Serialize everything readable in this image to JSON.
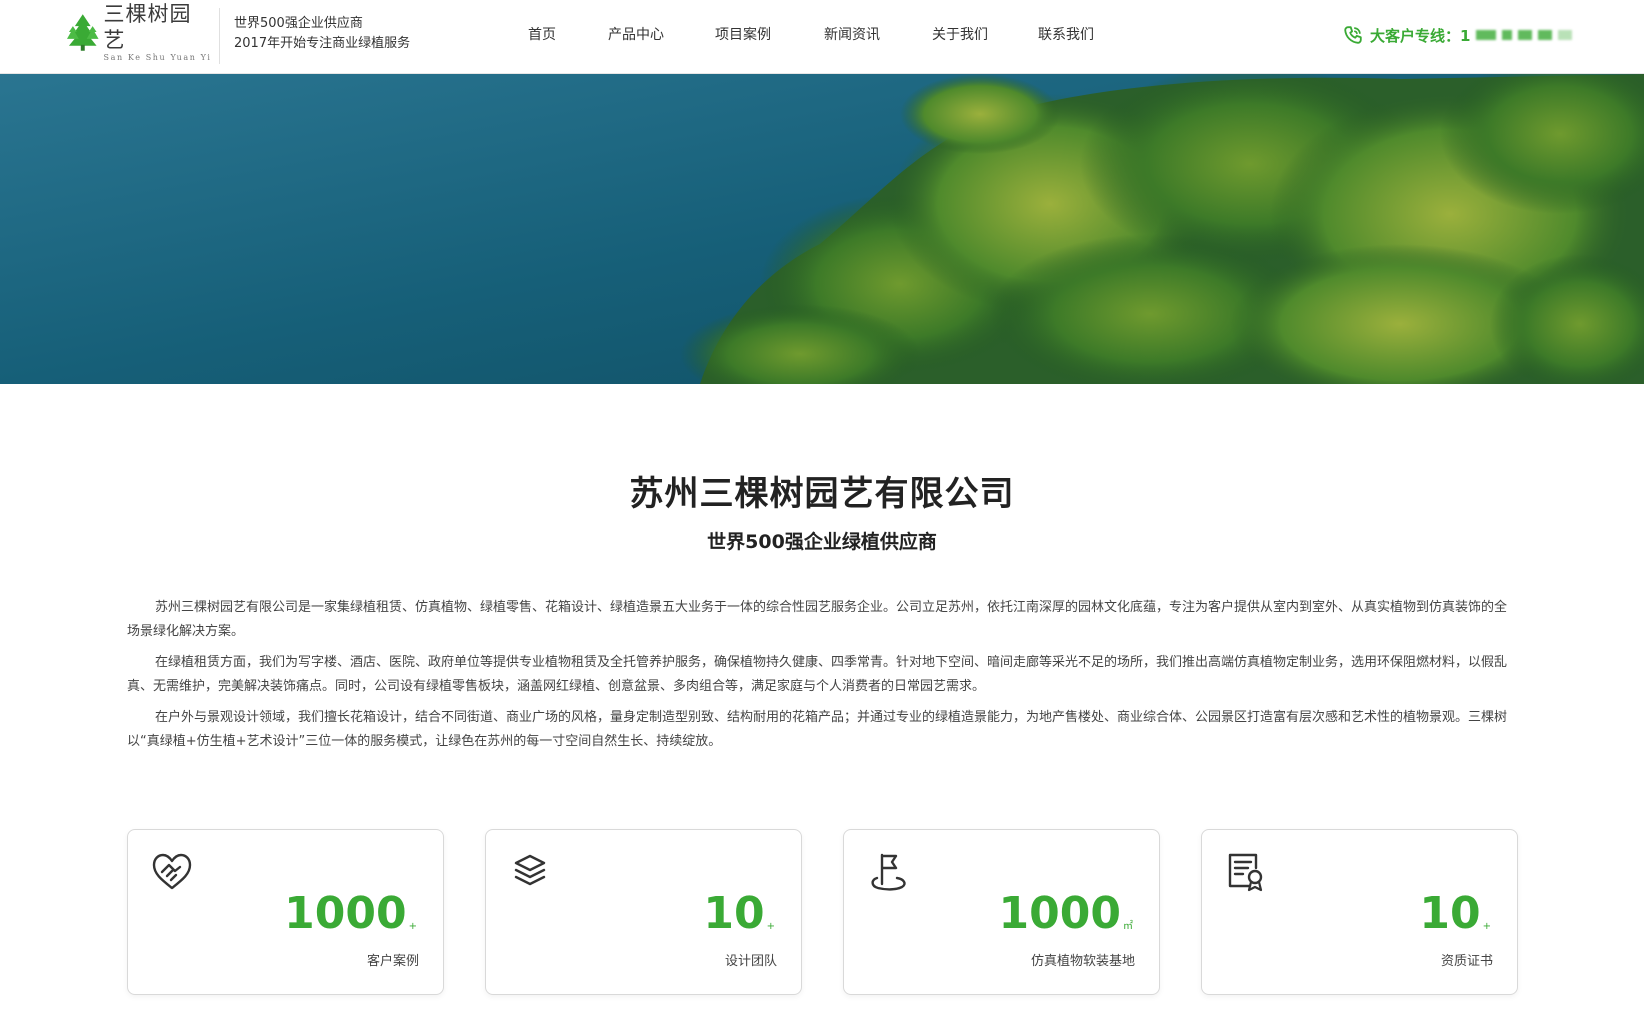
{
  "header": {
    "logo_cn": "三棵树园艺",
    "logo_en": "San Ke Shu Yuan Yi",
    "slogan_line1": "世界500强企业供应商",
    "slogan_line2": "2017年开始专注商业绿植服务",
    "nav": [
      "首页",
      "产品中心",
      "项目案例",
      "新闻资讯",
      "关于我们",
      "联系我们"
    ],
    "hotline_label": "大客户专线：1"
  },
  "intro": {
    "title": "苏州三棵树园艺有限公司",
    "subtitle": "世界500强企业绿植供应商",
    "paragraphs": [
      "苏州三棵树园艺有限公司是一家集绿植租赁、仿真植物、绿植零售、花箱设计、绿植造景五大业务于一体的综合性园艺服务企业。公司立足苏州，依托江南深厚的园林文化底蕴，专注为客户提供从室内到室外、从真实植物到仿真装饰的全场景绿化解决方案。",
      "在绿植租赁方面，我们为写字楼、酒店、医院、政府单位等提供专业植物租赁及全托管养护服务，确保植物持久健康、四季常青。针对地下空间、暗间走廊等采光不足的场所，我们推出高端仿真植物定制业务，选用环保阻燃材料，以假乱真、无需维护，完美解决装饰痛点。同时，公司设有绿植零售板块，涵盖网红绿植、创意盆景、多肉组合等，满足家庭与个人消费者的日常园艺需求。",
      "在户外与景观设计领域，我们擅长花箱设计，结合不同街道、商业广场的风格，量身定制造型别致、结构耐用的花箱产品；并通过专业的绿植造景能力，为地产售楼处、商业综合体、公园景区打造富有层次感和艺术性的植物景观。三棵树以“真绿植+仿生植+艺术设计”三位一体的服务模式，让绿色在苏州的每一寸空间自然生长、持续绽放。"
    ]
  },
  "stats": [
    {
      "icon": "handshake-heart-icon",
      "value": "1000",
      "unit": "+",
      "label": "客户案例"
    },
    {
      "icon": "layers-icon",
      "value": "10",
      "unit": "+",
      "label": "设计团队"
    },
    {
      "icon": "flag-icon",
      "value": "1000",
      "unit": "㎡",
      "label": "仿真植物软装基地"
    },
    {
      "icon": "certificate-icon",
      "value": "10",
      "unit": "+",
      "label": "资质证书"
    }
  ],
  "colors": {
    "accent": "#3aaa35",
    "text": "#222222"
  }
}
